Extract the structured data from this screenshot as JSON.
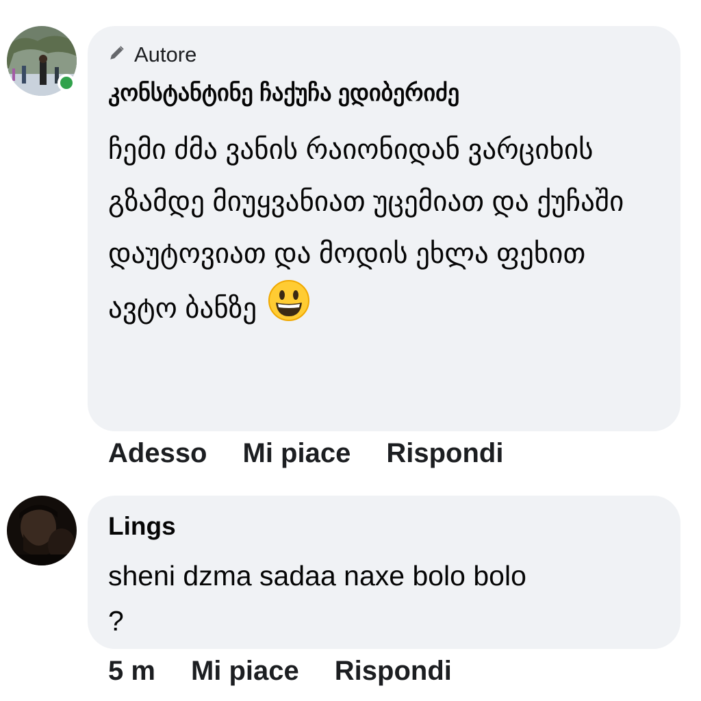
{
  "comments": [
    {
      "author_badge": "Autore",
      "author": "კონსტანტინე ჩაქუჩა ედიბერიძე",
      "text": "ჩემი ძმა ვანის რაიონიდან ვარციხის გზამდე მიუყვანიათ უცემიათ და ქუჩაში დაუტოვიათ და მოდის ეხლა ფეხით ავტო ბანზე",
      "emoji": "grinning-face",
      "time": "Adesso",
      "like_label": "Mi piace",
      "reply_label": "Rispondi",
      "online": true
    },
    {
      "author": "Lings",
      "text": "sheni dzma sadaa naxe bolo bolo ?",
      "time": "5 m",
      "like_label": "Mi piace",
      "reply_label": "Rispondi"
    }
  ],
  "colors": {
    "bubble": "#f0f2f5",
    "online": "#31a24c",
    "text": "#050505"
  }
}
